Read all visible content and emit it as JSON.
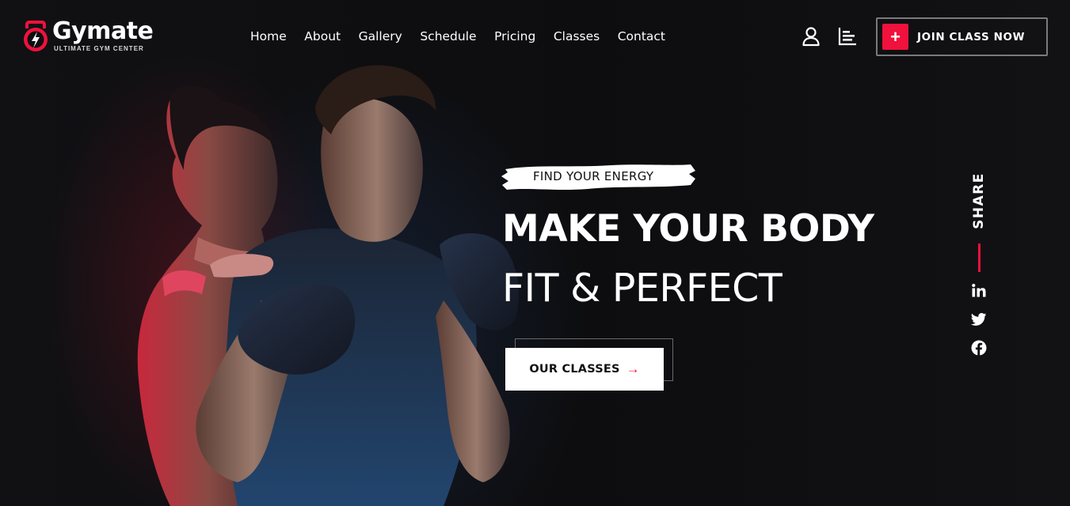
{
  "brand": {
    "name": "Gymate",
    "tagline": "ULTIMATE GYM CENTER",
    "accent_color": "#f0113d",
    "logo_icon": "kettlebell-bolt-icon"
  },
  "nav": {
    "items": [
      {
        "label": "Home"
      },
      {
        "label": "About"
      },
      {
        "label": "Gallery"
      },
      {
        "label": "Schedule"
      },
      {
        "label": "Pricing"
      },
      {
        "label": "Classes"
      },
      {
        "label": "Contact"
      }
    ]
  },
  "header": {
    "account_icon": "user-icon",
    "stats_icon": "bar-chart-icon",
    "join_button": {
      "icon": "plus-icon",
      "label": "JOIN CLASS NOW"
    }
  },
  "hero": {
    "tagline": "FIND YOUR ENERGY",
    "title_line1": "MAKE YOUR BODY",
    "title_line2": "FIT & PERFECT",
    "cta_label": "OUR CLASSES",
    "cta_icon": "arrow-right-icon"
  },
  "share": {
    "label": "SHARE",
    "links": [
      {
        "icon": "linkedin-icon"
      },
      {
        "icon": "twitter-icon"
      },
      {
        "icon": "facebook-icon"
      }
    ]
  }
}
